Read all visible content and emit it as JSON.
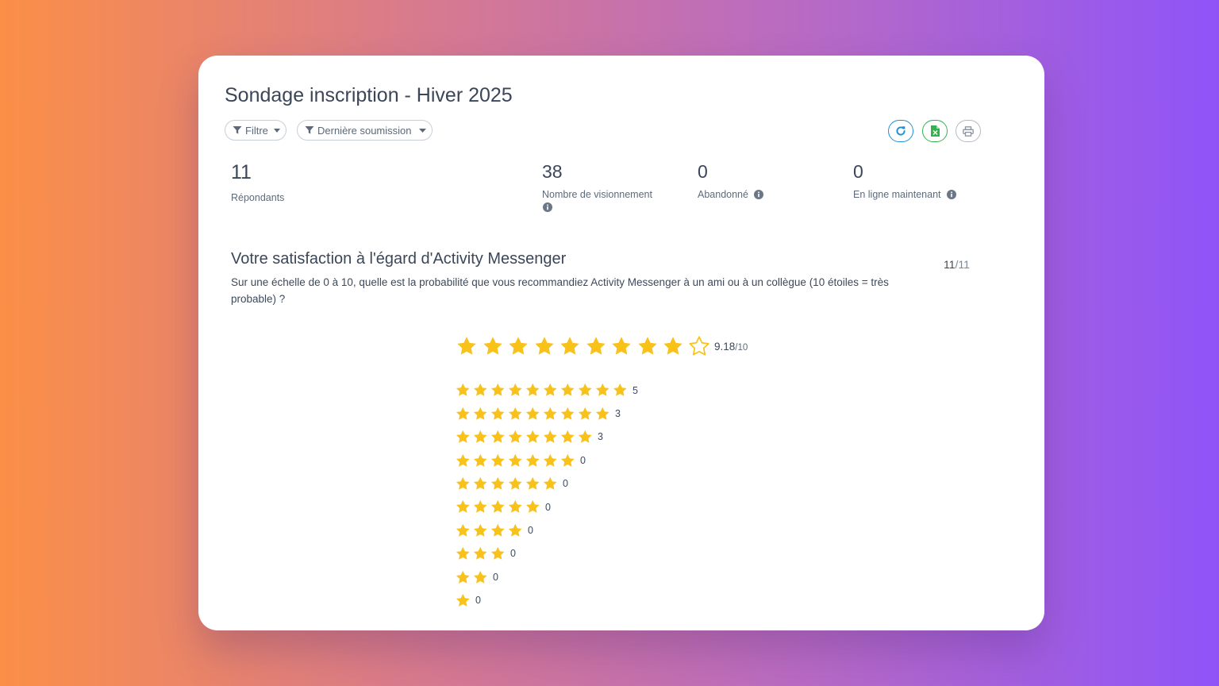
{
  "survey": {
    "title": "Sondage inscription - Hiver 2025"
  },
  "toolbar": {
    "filter_label": "Filtre",
    "submission_label": "Dernière soumission",
    "refresh_icon": "refresh-icon",
    "excel_icon": "excel-file-icon",
    "print_icon": "print-icon"
  },
  "stats": {
    "respondants": {
      "value": "11",
      "label": "Répondants"
    },
    "views": {
      "value": "38",
      "label": "Nombre de visionnement"
    },
    "abandoned": {
      "value": "0",
      "label": "Abandonné"
    },
    "online": {
      "value": "0",
      "label": "En ligne maintenant"
    }
  },
  "question": {
    "title": "Votre satisfaction à l'égard d'Activity Messenger",
    "answered": "11",
    "total": "/11",
    "description": "Sur une échelle de 0 à 10, quelle est la probabilité que vous recommandiez Activity Messenger à un ami ou à un collègue (10 étoiles = très probable) ?"
  },
  "rating": {
    "average": "9.18",
    "out_of": "/10",
    "max_stars": 10,
    "filled_stars": 9,
    "star_color": "#f8c21a",
    "distribution": [
      {
        "stars": 10,
        "count": "5"
      },
      {
        "stars": 9,
        "count": "3"
      },
      {
        "stars": 8,
        "count": "3"
      },
      {
        "stars": 7,
        "count": "0"
      },
      {
        "stars": 6,
        "count": "0"
      },
      {
        "stars": 5,
        "count": "0"
      },
      {
        "stars": 4,
        "count": "0"
      },
      {
        "stars": 3,
        "count": "0"
      },
      {
        "stars": 2,
        "count": "0"
      },
      {
        "stars": 1,
        "count": "0"
      }
    ]
  },
  "colors": {
    "refresh": "#1f8fd8",
    "excel": "#33b24e",
    "print": "#8c94a0",
    "info": "#6b7686"
  }
}
